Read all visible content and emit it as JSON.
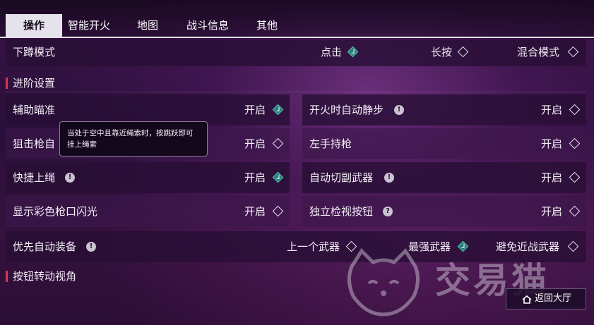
{
  "tabs": [
    {
      "label": "操作",
      "active": true
    },
    {
      "label": "智能开火",
      "active": false
    },
    {
      "label": "地图",
      "active": false
    },
    {
      "label": "战斗信息",
      "active": false
    },
    {
      "label": "其他",
      "active": false
    }
  ],
  "crouch": {
    "label": "下蹲模式",
    "options": [
      {
        "label": "点击",
        "selected": true
      },
      {
        "label": "长按",
        "selected": false
      },
      {
        "label": "混合模式",
        "selected": false
      }
    ]
  },
  "advanced": {
    "title": "进阶设置",
    "left": [
      {
        "label": "辅助瞄准",
        "value": "开启",
        "on": true,
        "info": false
      },
      {
        "label": "狙击枪自",
        "value": "开启",
        "on": false,
        "info": false
      },
      {
        "label": "快捷上绳",
        "value": "开启",
        "on": true,
        "info": true
      },
      {
        "label": "显示彩色枪口闪光",
        "value": "开启",
        "on": false,
        "info": false
      }
    ],
    "right": [
      {
        "label": "开火时自动静步",
        "value": "开启",
        "on": false,
        "info": true
      },
      {
        "label": "左手持枪",
        "value": "开启",
        "on": false,
        "info": false
      },
      {
        "label": "自动切副武器",
        "value": "开启",
        "on": false,
        "info": true
      },
      {
        "label": "独立检视按钮",
        "value": "开启",
        "on": false,
        "info": true,
        "info_glyph": "?"
      }
    ],
    "auto_equip": {
      "label": "优先自动装备",
      "options": [
        {
          "label": "上一个武器",
          "selected": false
        },
        {
          "label": "最强武器",
          "selected": true
        },
        {
          "label": "避免近战武器",
          "selected": false
        }
      ]
    }
  },
  "next_section_title": "按钮转动视角",
  "tooltip": {
    "text": "当处于空中且靠近绳索时，按跳跃即可挂上绳索"
  },
  "home_button": {
    "label": "返回大厅"
  },
  "watermark": {
    "text": "交易猫"
  },
  "colors": {
    "accent_teal": "#4cc6b8",
    "section_bar": "#e0364c",
    "tab_active_bg": "#e4e2ea"
  }
}
